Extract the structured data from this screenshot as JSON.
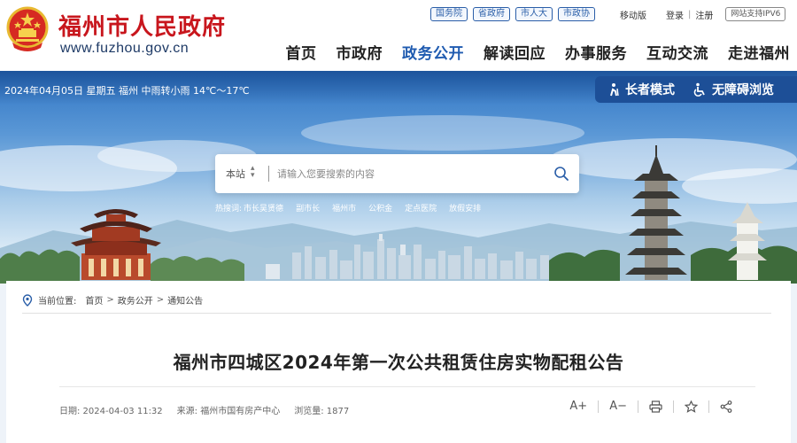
{
  "header": {
    "site_title": "福州市人民政府",
    "site_url": "www.fuzhou.gov.cn",
    "tag_links": [
      "国务院",
      "省政府",
      "市人大",
      "市政协"
    ],
    "mobile": "移动版",
    "login": "登录",
    "register": "注册",
    "separator": "|",
    "ipv6": "网站支持IPV6",
    "nav": [
      {
        "label": "首页",
        "active": false
      },
      {
        "label": "市政府",
        "active": false
      },
      {
        "label": "政务公开",
        "active": true
      },
      {
        "label": "解读回应",
        "active": false
      },
      {
        "label": "办事服务",
        "active": false
      },
      {
        "label": "互动交流",
        "active": false
      },
      {
        "label": "走进福州",
        "active": false
      }
    ]
  },
  "banner": {
    "weather": "2024年04月05日 星期五  福州 中雨转小雨 14℃～17℃",
    "elder_mode": "长者模式",
    "accessible": "无障碍浏览",
    "search": {
      "scope": "本站",
      "placeholder": "请输入您要搜索的内容"
    },
    "hot_label": "热搜词:",
    "hot_words": [
      "市长吴贤德",
      "副市长",
      "福州市",
      "公积金",
      "定点医院",
      "放假安排"
    ]
  },
  "breadcrumb": {
    "prefix": "当前位置:",
    "items": [
      "首页",
      "政务公开",
      "通知公告"
    ],
    "arrow": ">"
  },
  "article": {
    "title": "福州市四城区2024年第一次公共租赁住房实物配租公告",
    "date": "日期:  2024-04-03 11:32",
    "source": "来源:  福州市国有房产中心",
    "views": "浏览量:  1877",
    "font_larger": "A+",
    "font_smaller": "A−"
  },
  "colors": {
    "brand_red": "#c8161d",
    "nav_active": "#1f5bb0",
    "access_bar": "#1d4f97"
  },
  "icons": [
    "national-emblem-icon",
    "elder-mode-icon",
    "wheelchair-icon",
    "search-icon",
    "location-pin-icon",
    "print-icon",
    "star-icon",
    "share-icon"
  ]
}
